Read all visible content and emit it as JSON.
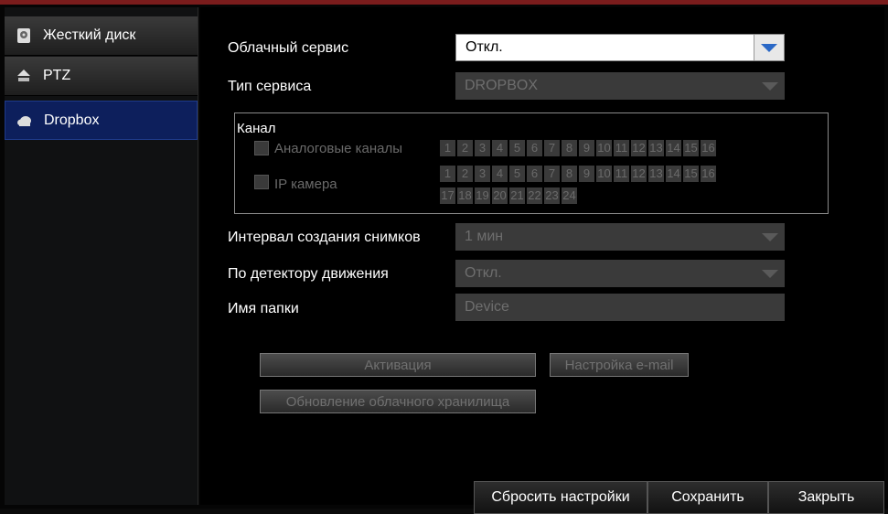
{
  "sidebar": {
    "items": [
      {
        "label": "Жесткий диск",
        "icon": "hard-disk-icon"
      },
      {
        "label": "PTZ",
        "icon": "ptz-camera-icon"
      },
      {
        "label": "Dropbox",
        "icon": "cloud-icon"
      }
    ]
  },
  "form": {
    "cloud_service_label": "Облачный сервис",
    "cloud_service_value": "Откл.",
    "service_type_label": "Тип сервиса",
    "service_type_value": "DROPBOX",
    "channel_group_title": "Канал",
    "analog_label": "Аналоговые каналы",
    "ip_label": "IP камера",
    "snapshot_interval_label": "Интервал создания снимков",
    "snapshot_interval_value": "1 мин",
    "motion_label": "По детектору движения",
    "motion_value": "Откл.",
    "folder_label": "Имя папки",
    "folder_value": "Device"
  },
  "channels": {
    "analog": [
      "1",
      "2",
      "3",
      "4",
      "5",
      "6",
      "7",
      "8",
      "9",
      "10",
      "11",
      "12",
      "13",
      "14",
      "15",
      "16"
    ],
    "ip_row1": [
      "1",
      "2",
      "3",
      "4",
      "5",
      "6",
      "7",
      "8",
      "9",
      "10",
      "11",
      "12",
      "13",
      "14",
      "15",
      "16"
    ],
    "ip_row2": [
      "17",
      "18",
      "19",
      "20",
      "21",
      "22",
      "23",
      "24"
    ]
  },
  "buttons": {
    "activate": "Активация",
    "email_setup": "Настройка e-mail",
    "cloud_update": "Обновление облачного хранилища",
    "reset": "Сбросить настройки",
    "save": "Сохранить",
    "close": "Закрыть"
  },
  "colors": {
    "active_sidebar": "#0d1f5c",
    "dropdown_arrow": "#2a68c6",
    "top_accent": "#7a1c1c"
  }
}
